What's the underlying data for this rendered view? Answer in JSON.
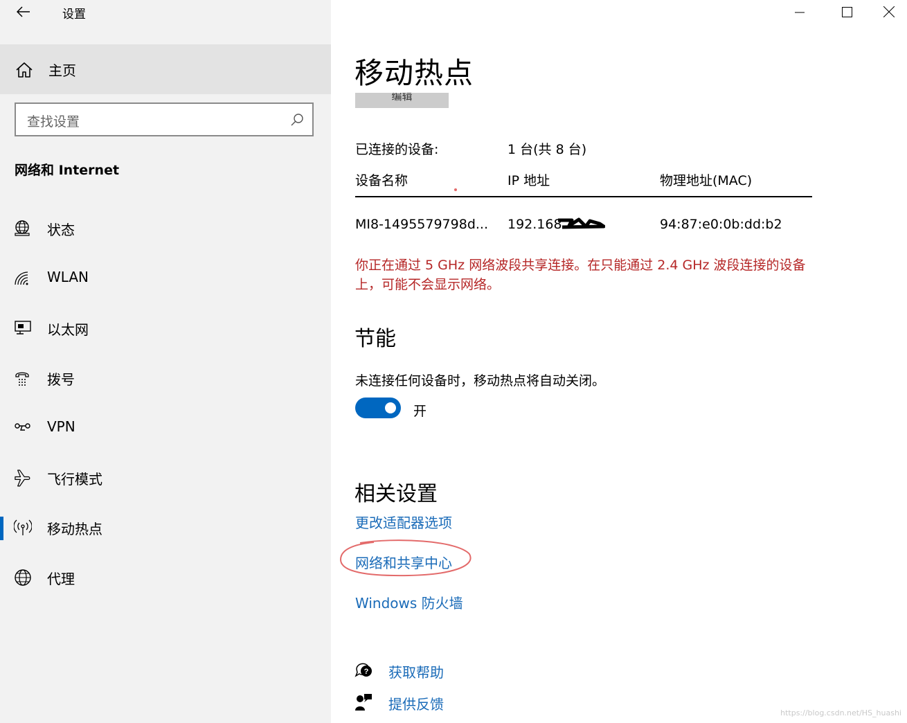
{
  "window": {
    "title": "设置",
    "minimize_icon": "minimize-icon",
    "maximize_icon": "maximize-icon",
    "close_icon": "close-icon"
  },
  "sidebar": {
    "home_label": "主页",
    "search_placeholder": "查找设置",
    "section_title": "网络和 Internet",
    "items": [
      {
        "label": "状态",
        "icon": "status-globe-icon",
        "active": false
      },
      {
        "label": "WLAN",
        "icon": "wifi-icon",
        "active": false
      },
      {
        "label": "以太网",
        "icon": "ethernet-icon",
        "active": false
      },
      {
        "label": "拨号",
        "icon": "dialup-icon",
        "active": false
      },
      {
        "label": "VPN",
        "icon": "vpn-icon",
        "active": false
      },
      {
        "label": "飞行模式",
        "icon": "airplane-icon",
        "active": false
      },
      {
        "label": "移动热点",
        "icon": "hotspot-icon",
        "active": true
      },
      {
        "label": "代理",
        "icon": "proxy-globe-icon",
        "active": false
      }
    ]
  },
  "main": {
    "title": "移动热点",
    "edit_label": "编辑",
    "connected_label": "已连接的设备:",
    "connected_value": "1 台(共 8 台)",
    "table": {
      "headers": [
        "设备名称",
        "IP 地址",
        "物理地址(MAC)"
      ],
      "rows": [
        [
          "MI8-1495579798d...",
          "192.168.1",
          "94:87:e0:0b:dd:b2"
        ]
      ]
    },
    "warning": "你正在通过 5 GHz 网络波段共享连接。在只能通过 2.4 GHz 波段连接的设备上，可能不会显示网络。",
    "power_saving": {
      "title": "节能",
      "description": "未连接任何设备时，移动热点将自动关闭。",
      "toggle_on": true,
      "toggle_label": "开"
    },
    "related": {
      "title": "相关设置",
      "links": [
        "更改适配器选项",
        "网络和共享中心",
        "Windows 防火墙"
      ]
    },
    "help": {
      "get_help": "获取帮助",
      "feedback": "提供反馈"
    }
  },
  "watermark": "https://blog.csdn.net/HS_huashi",
  "colors": {
    "accent": "#0067c0",
    "link": "#1a6bb8",
    "warning": "#b52626",
    "annotation": "#e36a6a"
  }
}
